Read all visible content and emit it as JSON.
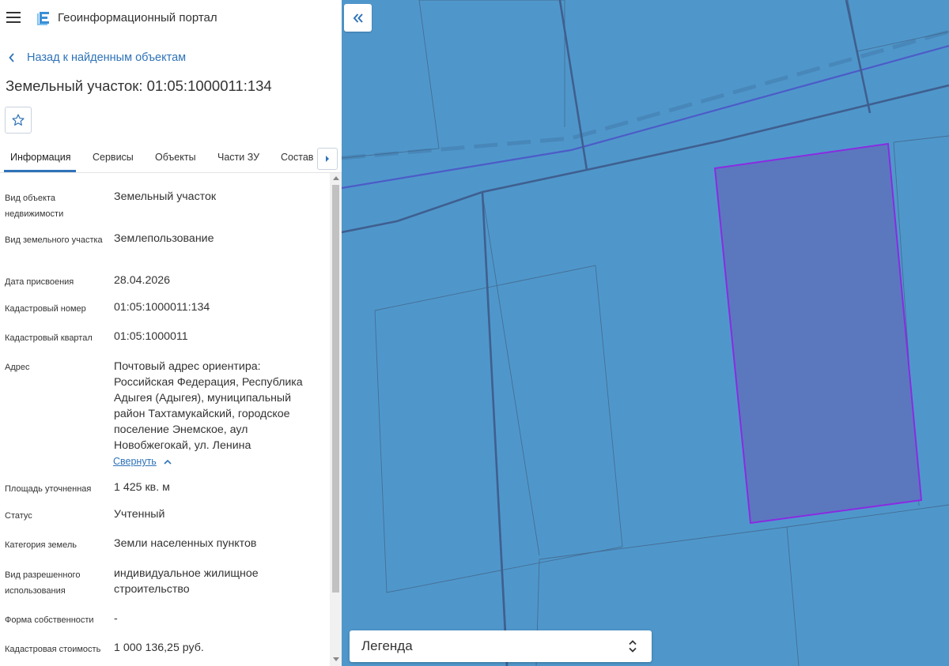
{
  "header": {
    "app_title": "Геоинформационный портал"
  },
  "nav": {
    "back_label": "Назад к найденным объектам"
  },
  "object": {
    "title": "Земельный участок: 01:05:1000011:134"
  },
  "tabs": [
    {
      "label": "Информация",
      "active": true
    },
    {
      "label": "Сервисы"
    },
    {
      "label": "Объекты"
    },
    {
      "label": "Части ЗУ"
    },
    {
      "label": "Состав"
    }
  ],
  "attributes": [
    {
      "label": "Вид объекта недвижимости",
      "value": "Земельный участок"
    },
    {
      "label": "Вид земельного участка",
      "value": "Землепользование"
    },
    {
      "label": "Дата присвоения",
      "value": "28.04.2026"
    },
    {
      "label": "Кадастровый номер",
      "value": "01:05:1000011:134"
    },
    {
      "label": "Кадастровый квартал",
      "value": "01:05:1000011"
    },
    {
      "label": "Адрес",
      "value": "Почтовый адрес ориентира: Российская Федерация, Республика Адыгея (Адыгея), муниципальный район Тахтамукайский, городское поселение Энемское, аул Новобжегокай, ул. Ленина"
    },
    {
      "label": "Площадь уточненная",
      "value": "1 425 кв. м"
    },
    {
      "label": "Статус",
      "value": "Учтенный"
    },
    {
      "label": "Категория земель",
      "value": "Земли населенных пунктов"
    },
    {
      "label": "Вид разрешенного использования",
      "value": "индивидуальное жилищное строительство"
    },
    {
      "label": "Форма собственности",
      "value": "-"
    },
    {
      "label": "Кадастровая стоимость",
      "value": "1 000 136,25 руб."
    }
  ],
  "address_collapse_label": "Свернуть",
  "map": {
    "legend_label": "Легенда",
    "colors": {
      "background": "#4f97cb",
      "parcel_fill": "#5b78bf",
      "parcel_stroke": "#8a2be2",
      "road": "#3f5f8f"
    }
  },
  "icons": {
    "menu": "hamburger-icon",
    "logo": "portal-logo-icon",
    "back": "chevron-left-icon",
    "favorite": "star-outline-icon",
    "tabs_next": "caret-right-icon",
    "collapse_panel": "double-chevron-left-icon",
    "legend_toggle": "unfold-arrows-icon"
  }
}
